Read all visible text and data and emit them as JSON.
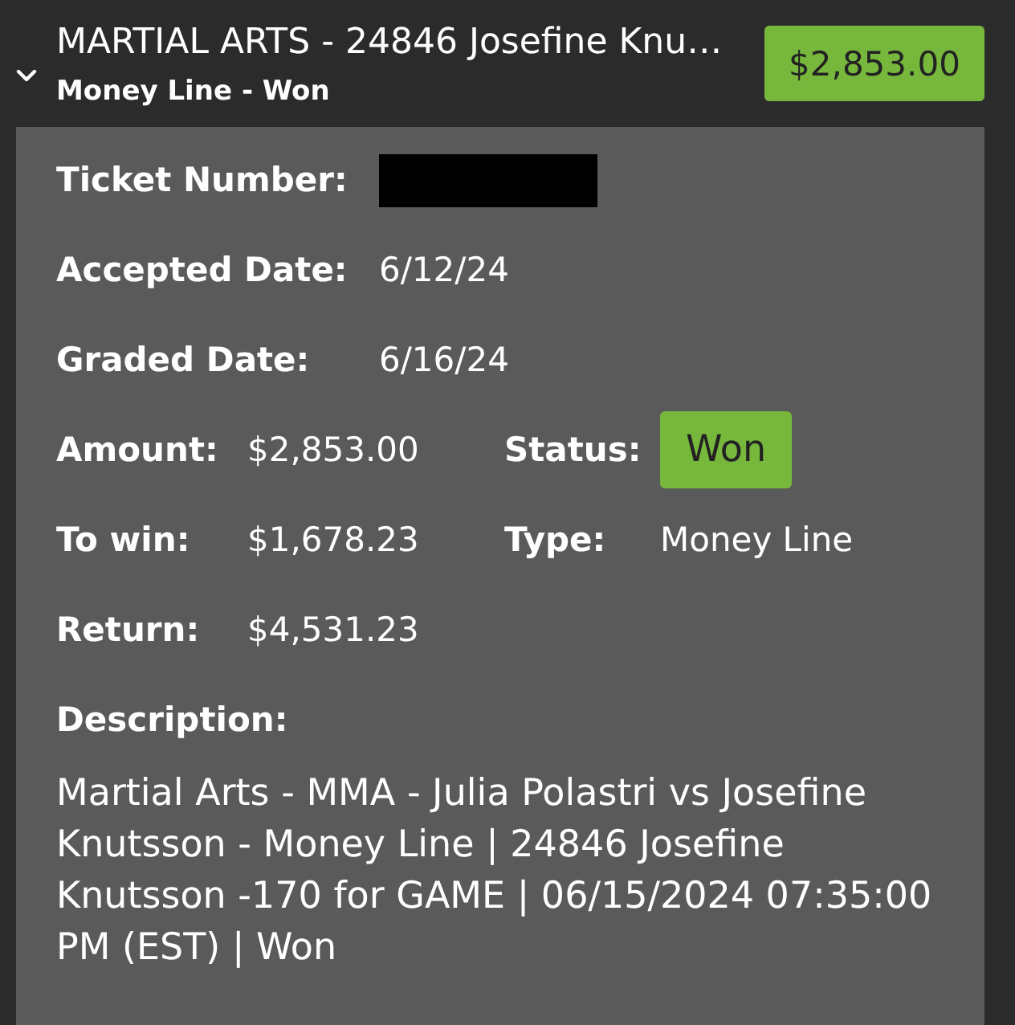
{
  "bet": {
    "title": "MARTIAL ARTS - 24846 Josefine Knu…",
    "subtitle": "Money Line - Won",
    "amount": "$2,853.00",
    "expanded": true
  },
  "detail_rows": [
    {
      "label": "Ticket Number:",
      "redacted": true
    },
    {
      "label": "Accepted Date:",
      "value": "6/12/24",
      "redacted": false
    },
    {
      "label": "Graded Date:",
      "value": "6/16/24",
      "redacted": false
    }
  ],
  "summary": [
    {
      "label": "Amount:",
      "value": "$2,853.00",
      "kind": "text"
    },
    {
      "label": "Status:",
      "value": "Won",
      "kind": "badge"
    },
    {
      "label": "To win:",
      "value": "$1,678.23",
      "kind": "text"
    },
    {
      "label": "Type:",
      "value": "Money Line",
      "kind": "text"
    },
    {
      "label": "Return:",
      "value": "$4,531.23",
      "kind": "text"
    }
  ],
  "description": {
    "label": "Description:",
    "text": "Martial Arts - MMA - Julia Polastri vs Josefine Knutsson - Money Line | 24846 Josefine Knutsson -170 for GAME | 06/15/2024 07:35:00 PM (EST) | Won"
  }
}
